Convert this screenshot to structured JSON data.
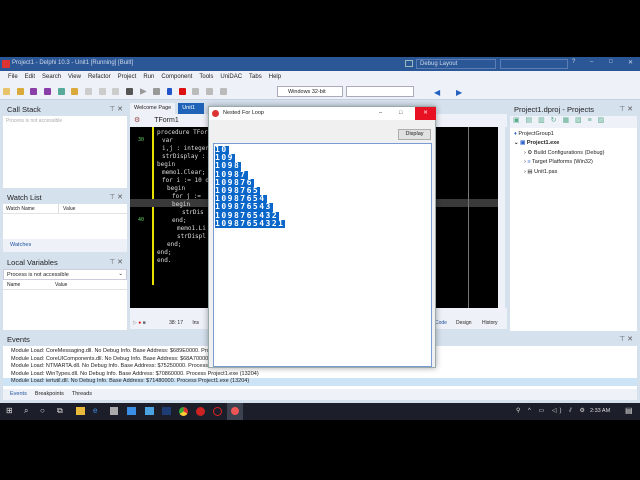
{
  "window": {
    "title": "Project1 - Delphi 10.3 - Unit1 [Running] [Built]",
    "layout": "Debug Layout"
  },
  "menu": [
    "File",
    "Edit",
    "Search",
    "View",
    "Refactor",
    "Project",
    "Run",
    "Component",
    "Tools",
    "UniDAC",
    "Tabs",
    "Help"
  ],
  "toolbar": {
    "platform": "Windows 32-bit"
  },
  "call_stack": {
    "title": "Call Stack",
    "status": "Process is not accessible"
  },
  "watch_list": {
    "title": "Watch List",
    "col_name": "Watch Name",
    "col_value": "Value",
    "tab": "Watches"
  },
  "local_vars": {
    "title": "Local Variables",
    "dropdown": "Process is not accessible",
    "col_name": "Name",
    "col_value": "Value"
  },
  "editor": {
    "tabs": [
      "Welcome Page",
      "Unit1"
    ],
    "form": "TForm1",
    "position": "38: 17",
    "mode": "Ins",
    "bottom_tabs": [
      "Code",
      "Design",
      "History"
    ],
    "line_numbers": [
      "30",
      "35",
      "40"
    ],
    "code": [
      "procedure TFor",
      "var",
      "i,j : integer;",
      "strDisplay :",
      "begin",
      "memo1.Clear;",
      "",
      "for i := 10 d",
      "begin",
      "for j := ",
      "begin",
      "strDis",
      "end;",
      "memo1.Li",
      "strDispl",
      "end;",
      "",
      "end;",
      "",
      "end."
    ]
  },
  "dialog": {
    "title": "Nested For Loop",
    "button": "Display",
    "memo_lines": [
      "10",
      "109",
      "1098",
      "10987",
      "109876",
      "1098765",
      "10987654",
      "109876543",
      "1098765432",
      "10987654321"
    ]
  },
  "projects": {
    "title": "Project1.dproj - Projects",
    "tree": [
      {
        "label": "ProjectGroup1"
      },
      {
        "label": "Project1.exe"
      },
      {
        "label": "Build Configurations (Debug)"
      },
      {
        "label": "Target Platforms (Win32)"
      },
      {
        "label": "Unit1.pas"
      }
    ]
  },
  "events": {
    "title": "Events",
    "lines": [
      "Module Load: CoreMessaging.dll. No Debug Info. Base Address: $689E0000. Proce",
      "Module Load: CoreUIComponents.dll. No Debug Info. Base Address: $68A70000. Proc",
      "Module Load: NTMARTA.dll. No Debug Info. Base Address: $75250000. Process P",
      "Module Load: WinTypes.dll. No Debug Info. Base Address: $70860000. Process Project1.exe (13204)",
      "Module Load: iertutil.dll. No Debug Info. Base Address: $71480000. Process Project1.exe (13204)"
    ],
    "tabs": [
      "Events",
      "Breakpoints",
      "Threads"
    ]
  },
  "taskbar": {
    "clock": "2:33 AM"
  }
}
